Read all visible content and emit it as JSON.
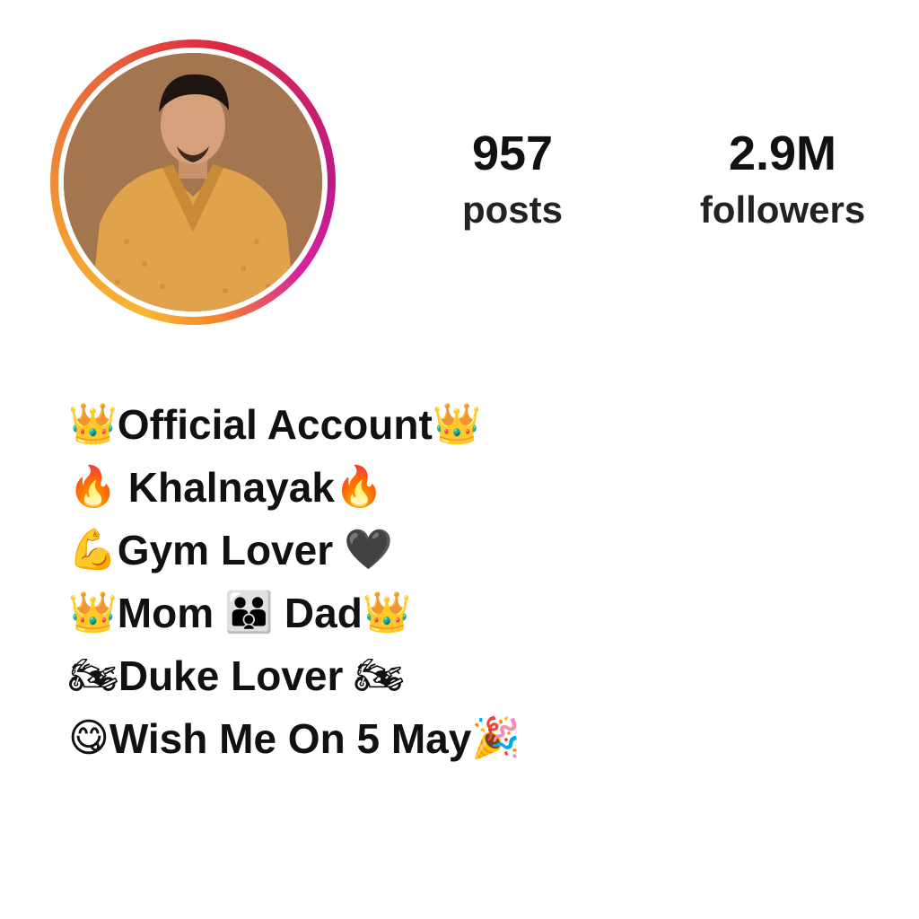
{
  "profile": {
    "avatar_alt": "Profile picture",
    "stats": {
      "posts_value": "957",
      "posts_label": "posts",
      "followers_value": "2.9M",
      "followers_label": "followers"
    },
    "bio": {
      "line1": {
        "prefix_emoji": "👑",
        "text": "Official Account",
        "suffix_emoji": "👑"
      },
      "line2": {
        "prefix_emoji": "🔥",
        "text": "Khalnayak",
        "suffix_emoji": "🔥"
      },
      "line3": {
        "prefix_emoji": "💪",
        "text": "Gym Lover",
        "suffix_emoji": "🖤"
      },
      "line4": {
        "prefix_emoji": "👑",
        "text_a": "Mom",
        "mid_emoji": "👪",
        "text_b": "Dad",
        "suffix_emoji": "👑"
      },
      "line5": {
        "prefix_emoji": "🏍",
        "text": "Duke Lover",
        "suffix_emoji": "🏍"
      },
      "line6": {
        "prefix_emoji": "😋",
        "text": "Wish Me On 5 May",
        "suffix_emoji": "🎉"
      }
    }
  },
  "colors": {
    "ring_start": "#f7b733",
    "ring_mid": "#dc2743",
    "ring_end": "#bc1888",
    "text": "#111111"
  }
}
